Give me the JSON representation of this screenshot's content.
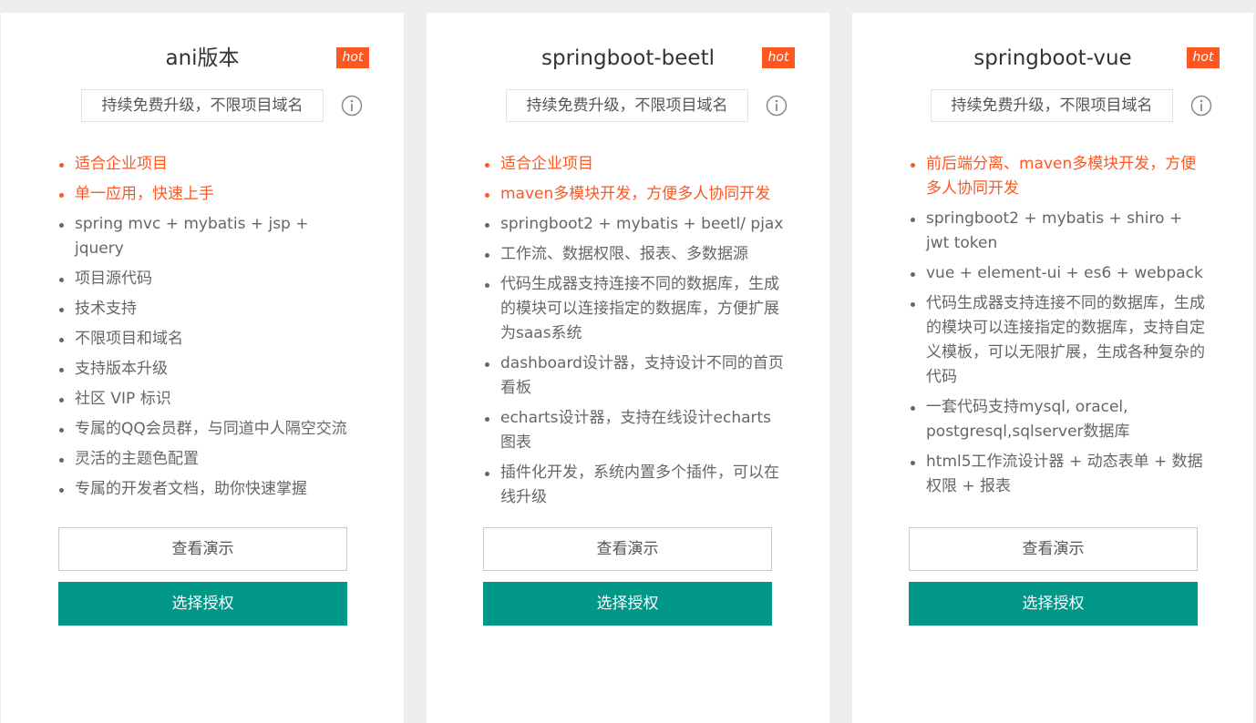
{
  "colors": {
    "accent_orange": "#ff5722",
    "primary_teal": "#009688",
    "text_gray": "#666666",
    "page_background": "#eeeeee"
  },
  "cards": [
    {
      "title": "ani版本",
      "badge": "hot",
      "subtitle": "持续免费升级，不限项目域名",
      "info_icon": "info-circle-icon",
      "features": [
        {
          "text": "适合企业项目",
          "highlight": true
        },
        {
          "text": "单一应用，快速上手",
          "highlight": true
        },
        {
          "text": "spring mvc + mybatis + jsp + jquery",
          "highlight": false
        },
        {
          "text": "项目源代码",
          "highlight": false
        },
        {
          "text": "技术支持",
          "highlight": false
        },
        {
          "text": "不限项目和域名",
          "highlight": false
        },
        {
          "text": "支持版本升级",
          "highlight": false
        },
        {
          "text": "社区 VIP 标识",
          "highlight": false
        },
        {
          "text": "专属的QQ会员群，与同道中人隔空交流",
          "highlight": false
        },
        {
          "text": "灵活的主题色配置",
          "highlight": false
        },
        {
          "text": "专属的开发者文档，助你快速掌握",
          "highlight": false
        }
      ],
      "demo_label": "查看演示",
      "license_label": "选择授权"
    },
    {
      "title": "springboot-beetl",
      "badge": "hot",
      "subtitle": "持续免费升级，不限项目域名",
      "info_icon": "info-circle-icon",
      "features": [
        {
          "text": "适合企业项目",
          "highlight": true
        },
        {
          "text": "maven多模块开发，方便多人协同开发",
          "highlight": true
        },
        {
          "text": "springboot2 + mybatis + beetl/ pjax",
          "highlight": false
        },
        {
          "text": "工作流、数据权限、报表、多数据源",
          "highlight": false
        },
        {
          "text": "代码生成器支持连接不同的数据库，生成的模块可以连接指定的数据库，方便扩展为saas系统",
          "highlight": false
        },
        {
          "text": "dashboard设计器，支持设计不同的首页看板",
          "highlight": false
        },
        {
          "text": "echarts设计器，支持在线设计echarts图表",
          "highlight": false
        },
        {
          "text": "插件化开发，系统内置多个插件，可以在线升级",
          "highlight": false
        }
      ],
      "demo_label": "查看演示",
      "license_label": "选择授权"
    },
    {
      "title": "springboot-vue",
      "badge": "hot",
      "subtitle": "持续免费升级，不限项目域名",
      "info_icon": "info-circle-icon",
      "features": [
        {
          "text": "前后端分离、maven多模块开发，方便多人协同开发",
          "highlight": true
        },
        {
          "text": "springboot2 + mybatis + shiro + jwt token",
          "highlight": false
        },
        {
          "text": "vue + element-ui + es6 + webpack",
          "highlight": false
        },
        {
          "text": "代码生成器支持连接不同的数据库，生成的模块可以连接指定的数据库，支持自定义模板，可以无限扩展，生成各种复杂的代码",
          "highlight": false
        },
        {
          "text": "一套代码支持mysql, oracel, postgresql,sqlserver数据库",
          "highlight": false
        },
        {
          "text": "html5工作流设计器 + 动态表单 + 数据权限 + 报表",
          "highlight": false
        }
      ],
      "demo_label": "查看演示",
      "license_label": "选择授权"
    }
  ]
}
